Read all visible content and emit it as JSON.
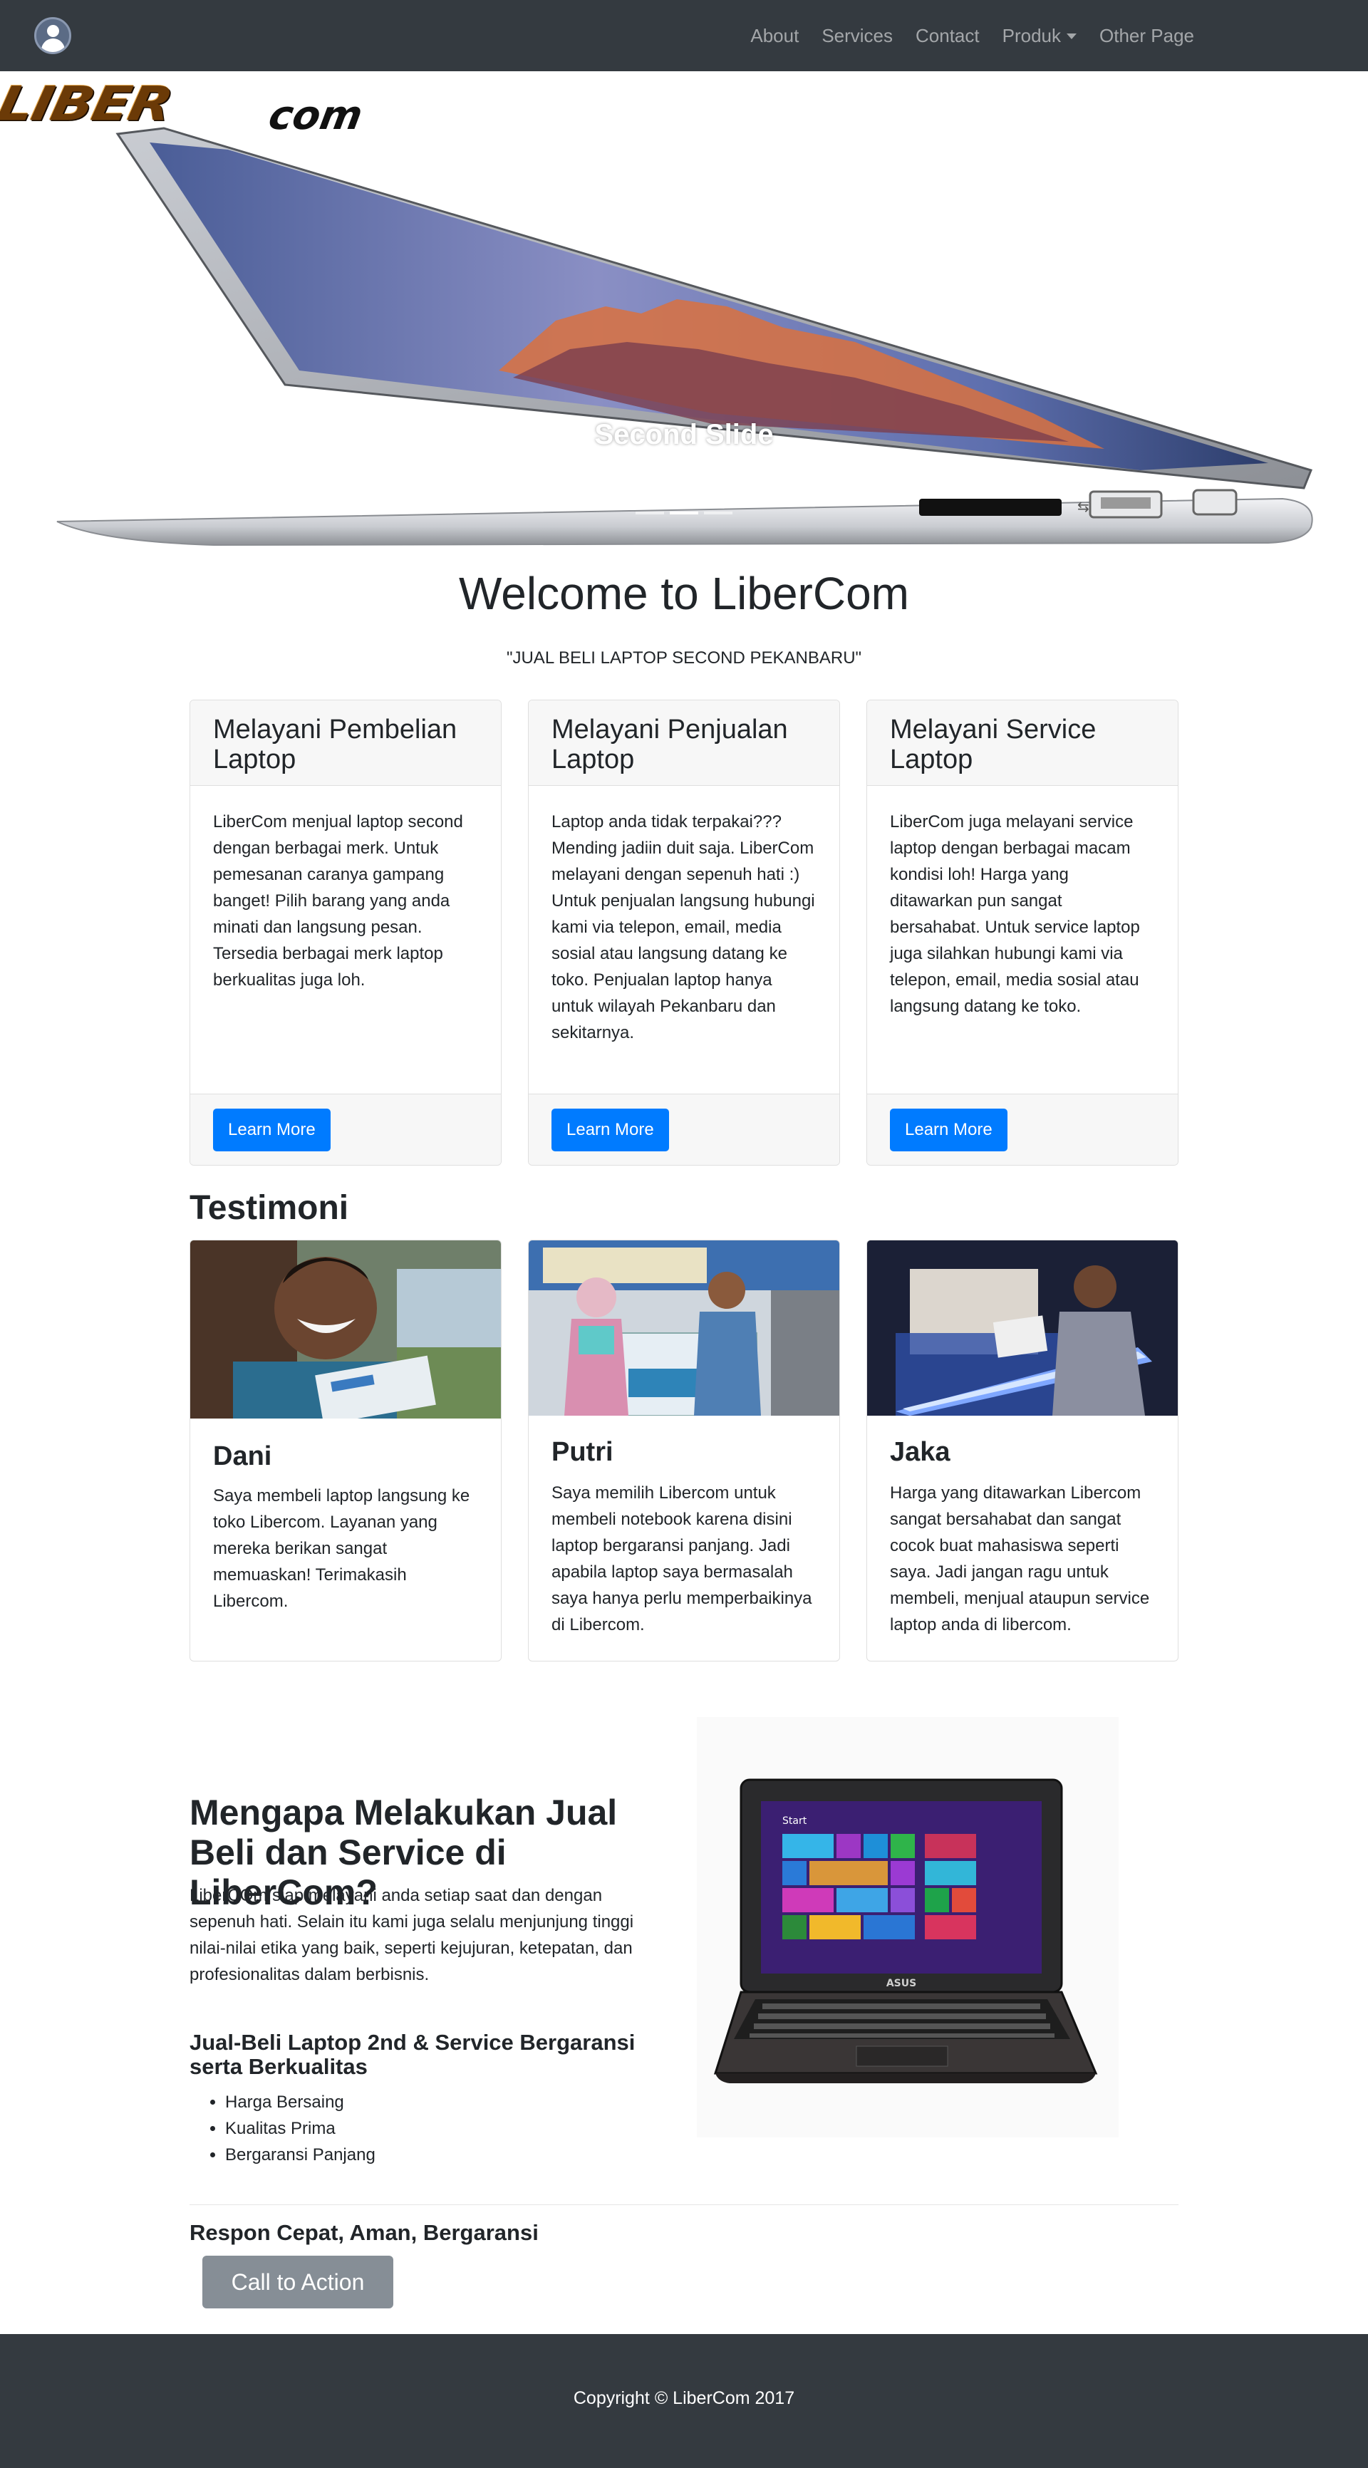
{
  "nav": {
    "links": [
      "About",
      "Services",
      "Contact",
      "Produk",
      "Other Page"
    ]
  },
  "hero": {
    "logo_main": "LIBER",
    "logo_suffix": "com",
    "caption": "Second Slide",
    "slide_count": 3,
    "active_slide": 2
  },
  "welcome": {
    "title": "Welcome to LiberCom",
    "tagline": "\"JUAL BELI LAPTOP SECOND PEKANBARU\""
  },
  "services": [
    {
      "title": "Melayani Pembelian Laptop",
      "text": "LiberCom menjual laptop second dengan berbagai merk. Untuk pemesanan caranya gampang banget! Pilih barang yang anda minati dan langsung pesan. Tersedia berbagai merk laptop berkualitas juga loh.",
      "button": "Learn More"
    },
    {
      "title": "Melayani Penjualan Laptop",
      "text": "Laptop anda tidak terpakai??? Mending jadiin duit saja. LiberCom melayani dengan sepenuh hati :)\nUntuk penjualan langsung hubungi kami via telepon, email, media sosial atau langsung datang ke toko. Penjualan laptop hanya untuk wilayah Pekanbaru dan sekitarnya.",
      "button": "Learn More"
    },
    {
      "title": "Melayani Service Laptop",
      "text": "LiberCom juga melayani service laptop dengan berbagai macam kondisi loh! Harga yang ditawarkan pun sangat bersahabat. Untuk service laptop juga silahkan hubungi kami via telepon, email, media sosial atau langsung datang ke toko.",
      "button": "Learn More"
    }
  ],
  "testimoni": {
    "title": "Testimoni",
    "items": [
      {
        "name": "Dani",
        "text": "Saya membeli laptop langsung ke toko Libercom. Layanan yang mereka berikan sangat memuaskan! Terimakasih Libercom."
      },
      {
        "name": "Putri",
        "text": "Saya memilih Libercom untuk membeli notebook karena disini laptop bergaransi panjang. Jadi apabila laptop saya bermasalah saya hanya perlu memperbaikinya di Libercom."
      },
      {
        "name": "Jaka",
        "text": "Harga yang ditawarkan Libercom sangat bersahabat dan sangat cocok buat mahasiswa seperti saya. Jadi jangan ragu untuk membeli, menjual ataupun service laptop anda di libercom."
      }
    ]
  },
  "why": {
    "title": "Mengapa Melakukan Jual Beli dan Service di LiberCom?",
    "text": "LiberCOm siap melayani anda setiap saat dan dengan sepenuh hati. Selain itu kami juga selalu menjunjung tinggi nilai-nilai etika yang baik, seperti kejujuran, ketepatan, dan profesionalitas dalam berbisnis.",
    "subtitle": "Jual-Beli Laptop 2nd & Service Bergaransi serta Berkualitas",
    "list": [
      "Harga Bersaing",
      "Kualitas Prima",
      "Bergaransi Panjang"
    ],
    "laptop_screen_label": "Start",
    "laptop_brand": "ASUS"
  },
  "cta": {
    "text": "Respon Cepat, Aman, Bergaransi",
    "button": "Call to Action"
  },
  "footer": {
    "copyright": "Copyright © LiberCom 2017"
  },
  "colors": {
    "navbar": "#343a40",
    "primary": "#007bff",
    "secondary": "#868e96",
    "card_header": "#f7f7f7"
  }
}
